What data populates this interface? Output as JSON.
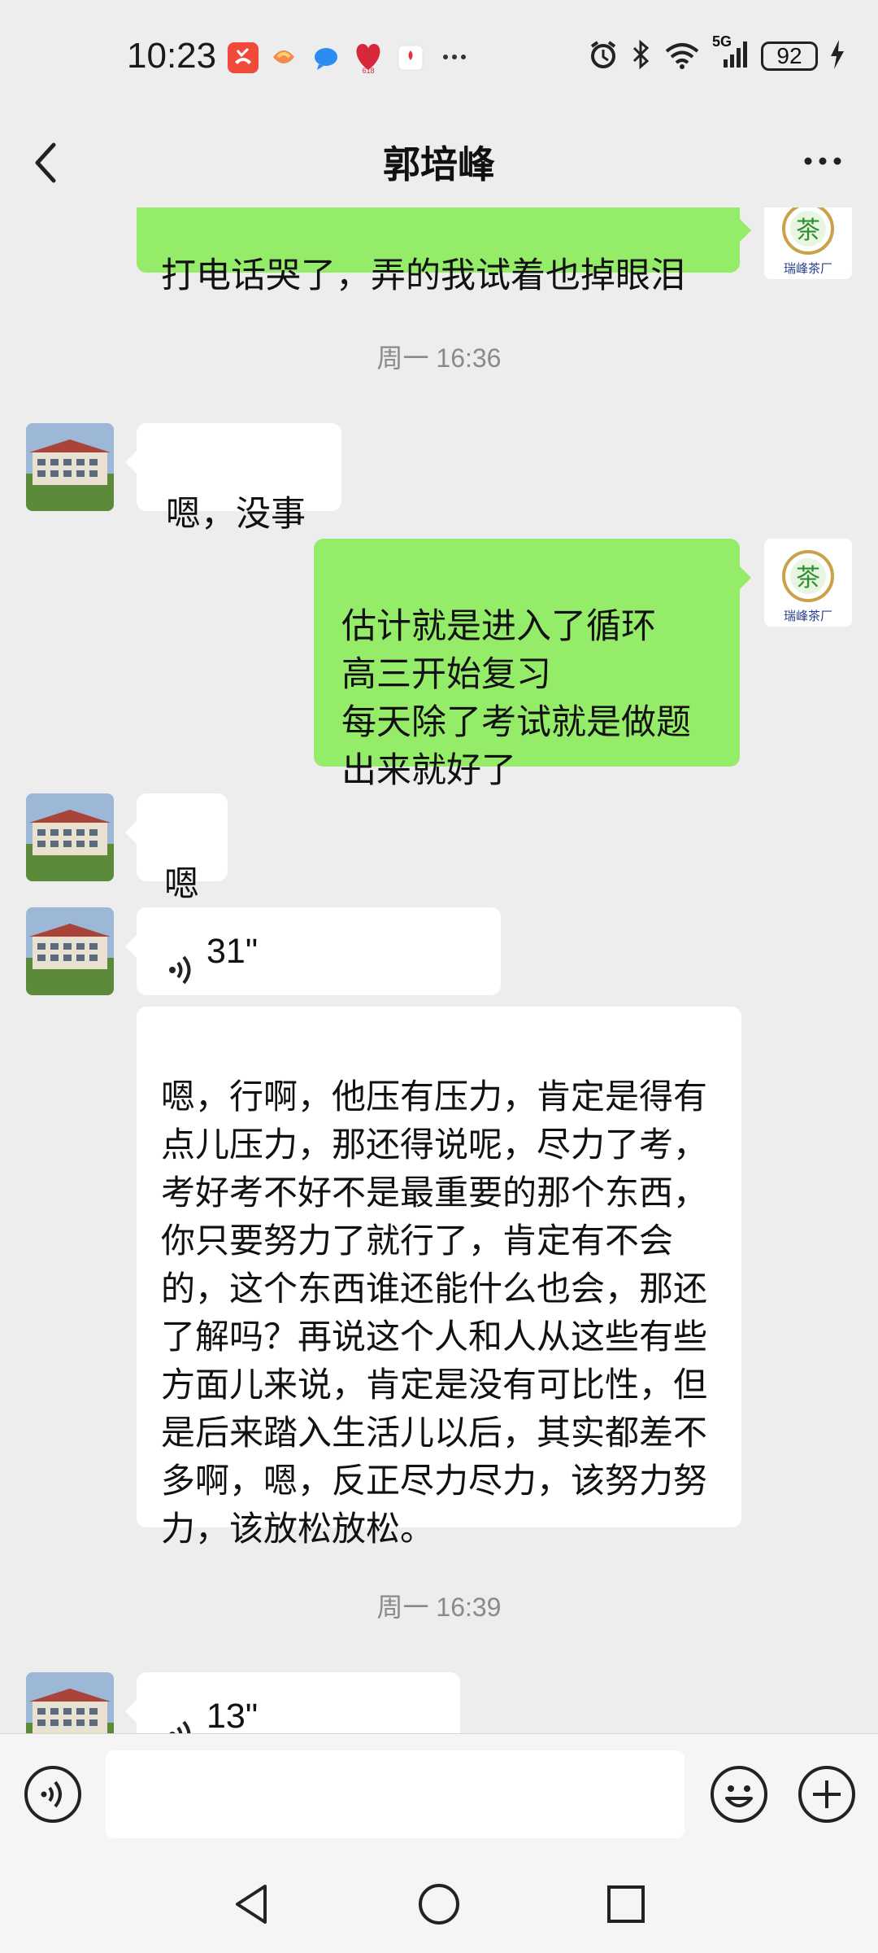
{
  "status_bar": {
    "time": "10:23",
    "battery": "92",
    "network": "5G",
    "notification_icons": [
      "missed-call-icon",
      "app-icon",
      "message-icon",
      "shopping-618-icon",
      "huawei-app-icon",
      "more-dots-icon"
    ],
    "system_icons": [
      "alarm-icon",
      "bluetooth-icon",
      "wifi-icon",
      "signal-icon",
      "battery-icon",
      "charging-icon"
    ]
  },
  "header": {
    "title": "郭培峰",
    "back_icon": "chevron-left-icon",
    "more_icon": "more-horizontal-icon"
  },
  "colors": {
    "background": "#ededed",
    "outgoing_bubble": "#95ec69",
    "incoming_bubble": "#ffffff",
    "timestamp_text": "#8a8a8a"
  },
  "messages": [
    {
      "type": "text",
      "direction": "out",
      "text": "打电话哭了，弄的我试着也掉眼泪",
      "avatar_label": "瑞峰茶厂",
      "avatar_char": "茶"
    },
    {
      "type": "timestamp",
      "text": "周一 16:36"
    },
    {
      "type": "text",
      "direction": "in",
      "text": "嗯，没事"
    },
    {
      "type": "text",
      "direction": "out",
      "text": "估计就是进入了循环\n高三开始复习\n每天除了考试就是做题\n出来就好了",
      "avatar_label": "瑞峰茶厂",
      "avatar_char": "茶"
    },
    {
      "type": "text",
      "direction": "in",
      "text": "嗯"
    },
    {
      "type": "voice",
      "direction": "in",
      "duration": "31\""
    },
    {
      "type": "transcript",
      "direction": "in",
      "text": "嗯，行啊，他压有压力，肯定是得有点儿压力，那还得说呢，尽力了考，考好考不好不是最重要的那个东西，你只要努力了就行了，肯定有不会的，这个东西谁还能什么也会，那还了解吗？再说这个人和人从这些有些方面儿来说，肯定是没有可比性，但是后来踏入生活儿以后，其实都差不多啊，嗯，反正尽力尽力，该努力努力，该放松放松。"
    },
    {
      "type": "timestamp",
      "text": "周一 16:39"
    },
    {
      "type": "voice",
      "direction": "in",
      "duration": "13\""
    }
  ],
  "input_bar": {
    "voice_icon": "voice-input-icon",
    "emoji_icon": "emoji-icon",
    "plus_icon": "plus-circle-icon",
    "text": ""
  },
  "system_nav": [
    "back-triangle-icon",
    "home-circle-icon",
    "recents-square-icon"
  ]
}
